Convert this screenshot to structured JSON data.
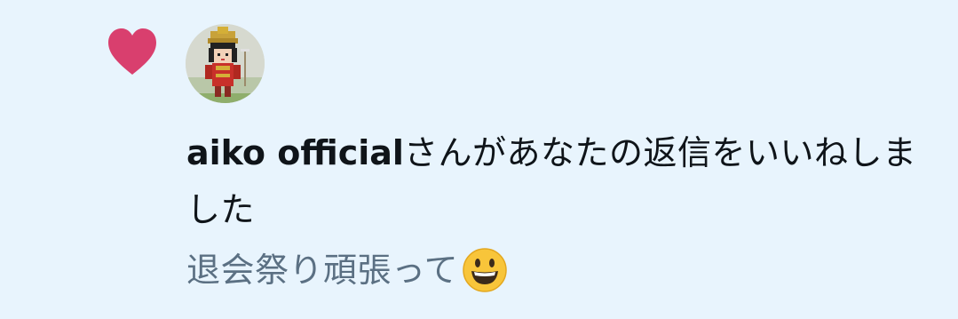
{
  "notification": {
    "type": "like",
    "username": "aiko official",
    "action_text": "さんがあなたの返信をいいねしました",
    "reply_text": "退会祭り頑張って",
    "reply_emoji": "grinning-face-emoji",
    "heart_icon": "heart-icon",
    "colors": {
      "heart": "#d93f6e",
      "background": "#e8f4fd",
      "primary_text": "#0f1419",
      "secondary_text": "#5b7083"
    }
  }
}
